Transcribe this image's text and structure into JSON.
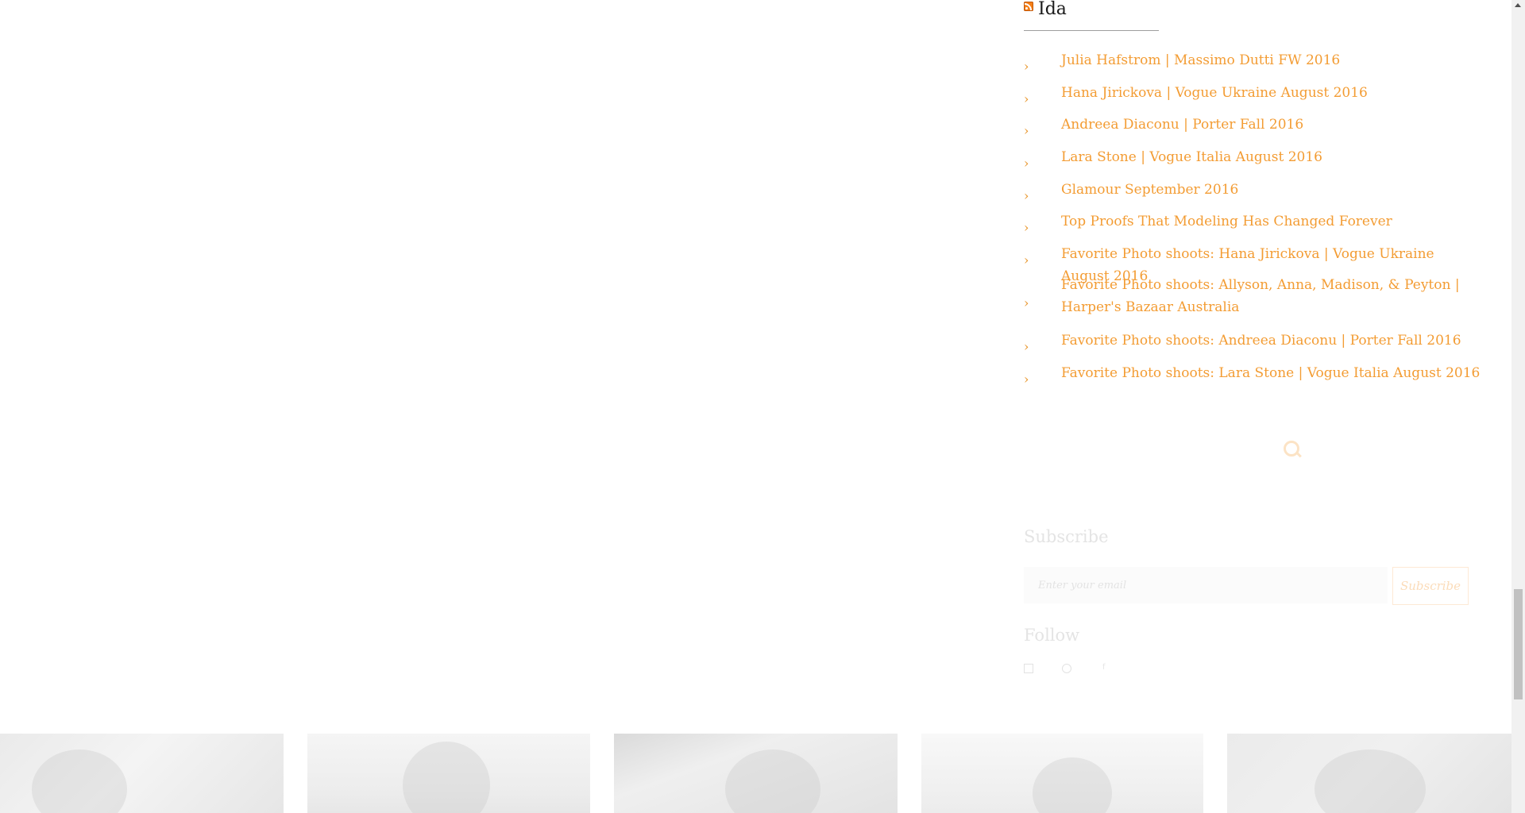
{
  "widget": {
    "title": "Ida",
    "icon": "rss-icon",
    "posts": [
      "Julia Hafstrom | Massimo Dutti FW 2016",
      "Hana Jirickova | Vogue Ukraine August 2016",
      "Andreea Diaconu | Porter Fall 2016",
      "Lara Stone | Vogue Italia August 2016",
      "Glamour September 2016",
      "Top Proofs That Modeling Has Changed Forever",
      "Favorite Photo shoots: Hana Jirickova | Vogue Ukraine August 2016",
      "Favorite Photo shoots: Allyson, Anna, Madison, & Peyton | Harper's Bazaar Australia",
      "Favorite Photo shoots: Andreea Diaconu | Porter Fall 2016",
      "Favorite Photo shoots: Lara Stone | Vogue Italia August 2016"
    ]
  },
  "search": {
    "icon": "search-icon"
  },
  "subscribe": {
    "heading": "Subscribe",
    "placeholder": "Enter your email",
    "button_label": "Subscribe"
  },
  "follow": {
    "heading": "Follow",
    "icons": [
      "instagram-icon",
      "pinterest-icon",
      "facebook-icon"
    ],
    "facebook_glyph": "f"
  },
  "colors": {
    "link": "#f39c33",
    "chevron": "#e8952a",
    "title": "#1a1a1a"
  }
}
